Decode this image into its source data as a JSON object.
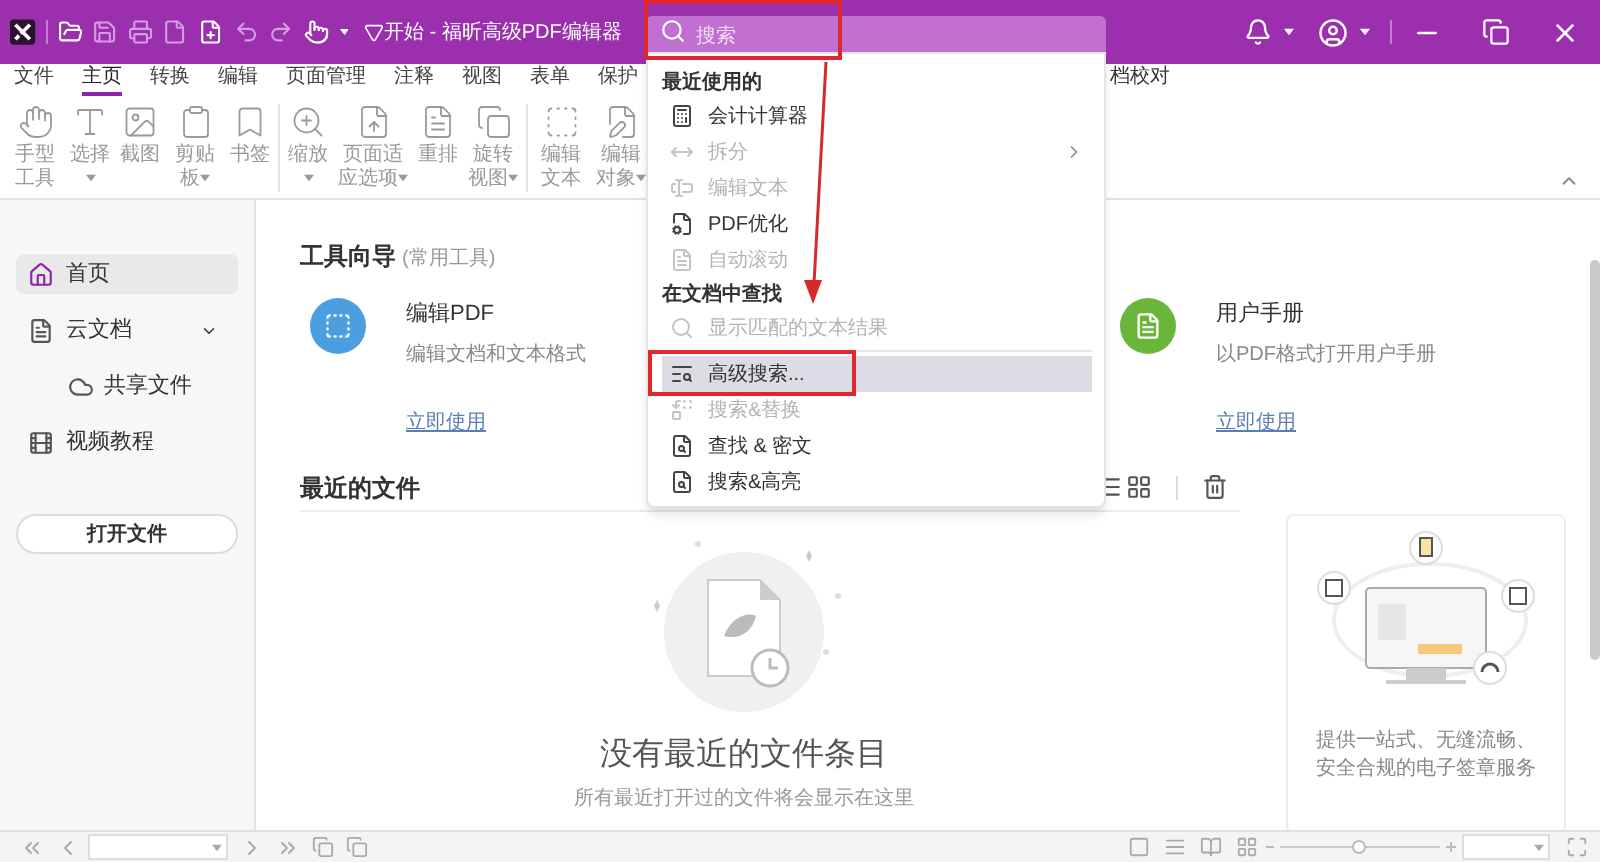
{
  "title_bar": {
    "title": "开始 - 福昕高级PDF编辑器",
    "search": {
      "placeholder": "搜索"
    }
  },
  "menu_tabs": [
    {
      "label": "文件",
      "selected": false
    },
    {
      "label": "主页",
      "selected": true
    },
    {
      "label": "转换",
      "selected": false
    },
    {
      "label": "编辑",
      "selected": false
    },
    {
      "label": "页面管理",
      "selected": false
    },
    {
      "label": "注释",
      "selected": false
    },
    {
      "label": "视图",
      "selected": false
    },
    {
      "label": "表单",
      "selected": false
    },
    {
      "label": "保护",
      "selected": false
    }
  ],
  "partial_tab": {
    "label": "档校对",
    "selected": false
  },
  "ribbon_groups": [
    {
      "items": [
        {
          "label": "手型工具",
          "has_menu": false
        },
        {
          "label": "选择",
          "has_menu": true
        },
        {
          "label": "截图",
          "has_menu": false
        },
        {
          "label": "剪贴板",
          "has_menu": true
        },
        {
          "label": "书签",
          "has_menu": false
        }
      ]
    },
    {
      "items": [
        {
          "label": "缩放",
          "has_menu": true
        },
        {
          "label": "页面适应选项",
          "has_menu": true
        },
        {
          "label": "重排",
          "has_menu": false
        },
        {
          "label": "旋转视图",
          "has_menu": true
        }
      ]
    },
    {
      "items": [
        {
          "label": "编辑文本",
          "has_menu": false
        },
        {
          "label": "编辑对象",
          "has_menu": true
        }
      ]
    }
  ],
  "sidebar": {
    "items": [
      {
        "label": "首页",
        "selected": true
      },
      {
        "label": "云文档",
        "selected": false,
        "expanded": true,
        "children": [
          {
            "label": "共享文件",
            "selected": false
          }
        ]
      },
      {
        "label": "视频教程",
        "selected": false
      }
    ],
    "open_button": "打开文件"
  },
  "tool_guide": {
    "title": "工具向导",
    "subtitle": "(常用工具)",
    "cards": [
      {
        "title": "编辑PDF",
        "description": "编辑文档和文本格式",
        "link": "立即使用",
        "color": "#4b9fe1"
      },
      {
        "title": "用户手册",
        "description": "以PDF格式打开用户手册",
        "link": "立即使用",
        "color": "#6ab63a"
      }
    ]
  },
  "recent_files": {
    "title": "最近的文件",
    "empty_title": "没有最近的文件条目",
    "empty_hint": "所有最近打开过的文件将会显示在这里"
  },
  "promo": {
    "text": "提供一站式、无缝流畅、安全合规的电子签章服务"
  },
  "search_menu": {
    "sections": [
      {
        "title": "最近使用的",
        "items": [
          {
            "label": "会计计算器",
            "kind": "command",
            "disabled": false,
            "submenu": false,
            "selected": false
          },
          {
            "label": "拆分",
            "kind": "command",
            "disabled": true,
            "submenu": true,
            "selected": false
          },
          {
            "label": "编辑文本",
            "kind": "command",
            "disabled": true,
            "submenu": false,
            "selected": false
          },
          {
            "label": "PDF优化",
            "kind": "command",
            "disabled": false,
            "submenu": false,
            "selected": false
          },
          {
            "label": "自动滚动",
            "kind": "command",
            "disabled": true,
            "submenu": false,
            "selected": false
          }
        ]
      },
      {
        "title": "在文档中查找",
        "items": [
          {
            "label": "显示匹配的文本结果",
            "kind": "hint",
            "disabled": true,
            "submenu": false,
            "selected": false
          },
          {
            "label": "高级搜索...",
            "kind": "command",
            "disabled": false,
            "submenu": false,
            "selected": true
          },
          {
            "label": "搜索&替换",
            "kind": "command",
            "disabled": true,
            "submenu": false,
            "selected": false
          },
          {
            "label": "查找 & 密文",
            "kind": "command",
            "disabled": false,
            "submenu": false,
            "selected": false
          },
          {
            "label": "搜索&高亮",
            "kind": "command",
            "disabled": false,
            "submenu": false,
            "selected": false
          }
        ]
      }
    ]
  },
  "status_bar": {
    "zoom_slider": {
      "level": 0.5
    }
  }
}
